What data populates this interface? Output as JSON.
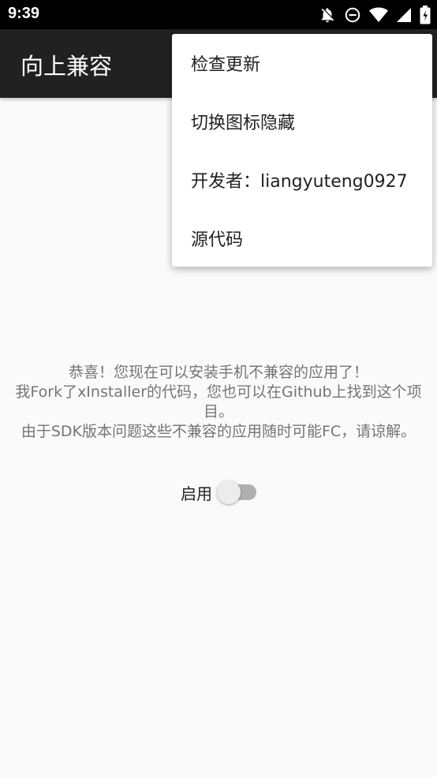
{
  "status_bar": {
    "time": "9:39",
    "icons": [
      "notifications-off-icon",
      "do-not-disturb-icon",
      "wifi-icon",
      "cellular-signal-icon",
      "battery-icon"
    ]
  },
  "app_bar": {
    "title": "向上兼容",
    "background": "#212121"
  },
  "overflow_menu": {
    "items": [
      {
        "label": "检查更新"
      },
      {
        "label": "切换图标隐藏"
      },
      {
        "label": "开发者：liangyuteng0927"
      },
      {
        "label": "源代码"
      }
    ]
  },
  "content": {
    "line1": "恭喜！您现在可以安装手机不兼容的应用了！",
    "line2": "我Fork了xInstaller的代码，您也可以在Github上找到这个项目。",
    "line3": "由于SDK版本问题这些不兼容的应用随时可能FC，请谅解。"
  },
  "toggle": {
    "label": "启用",
    "checked": false
  }
}
